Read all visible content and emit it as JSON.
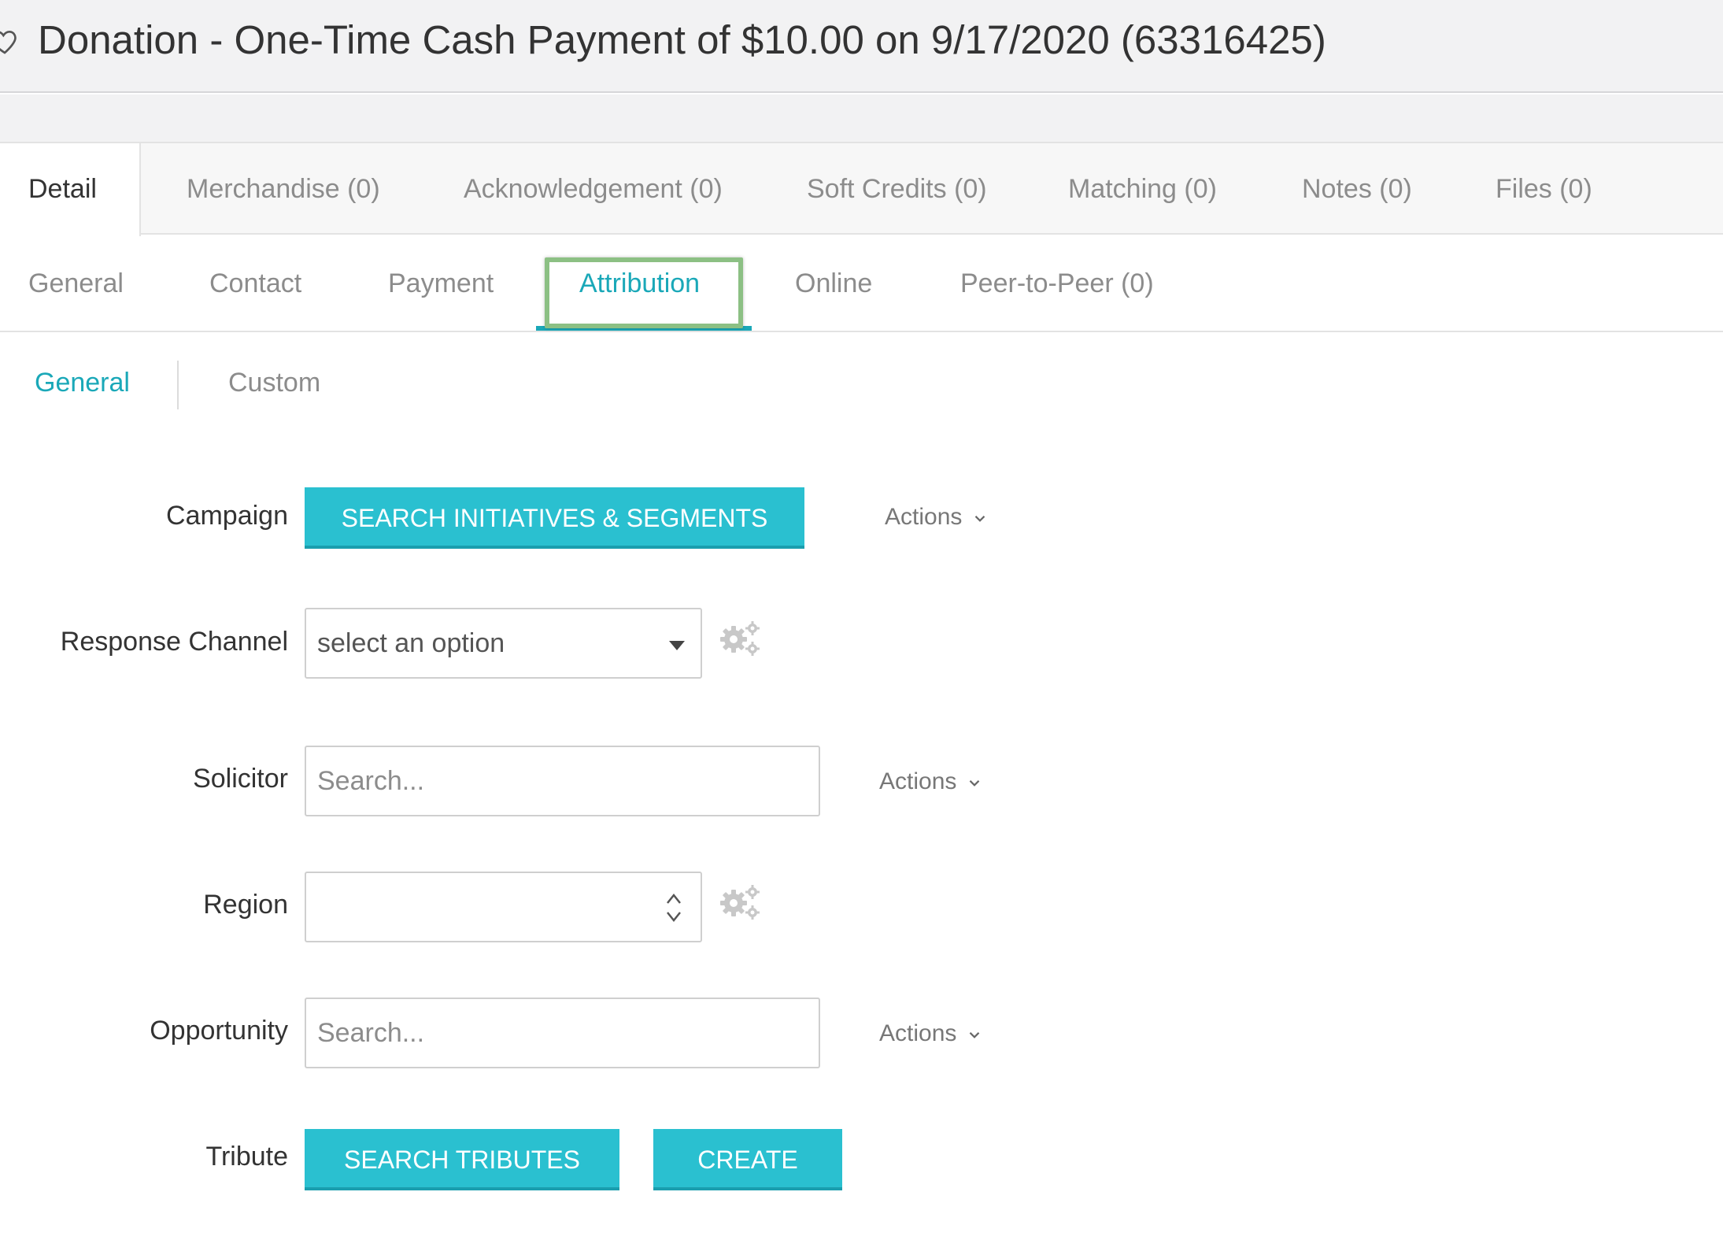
{
  "header": {
    "title": "Donation - One-Time Cash Payment of $10.00 on 9/17/2020 (63316425)",
    "favorite_icon": "heart-outline-icon"
  },
  "main_tabs": [
    {
      "label": "Detail",
      "active": true
    },
    {
      "label": "Merchandise (0)"
    },
    {
      "label": "Acknowledgement (0)"
    },
    {
      "label": "Soft Credits (0)"
    },
    {
      "label": "Matching (0)"
    },
    {
      "label": "Notes (0)"
    },
    {
      "label": "Files (0)"
    }
  ],
  "sub_tabs": [
    {
      "label": "General"
    },
    {
      "label": "Contact"
    },
    {
      "label": "Payment"
    },
    {
      "label": "Attribution",
      "active": true
    },
    {
      "label": "Online"
    },
    {
      "label": "Peer-to-Peer (0)"
    }
  ],
  "section_tabs": [
    {
      "label": "General",
      "active": true
    },
    {
      "label": "Custom"
    }
  ],
  "form": {
    "campaign": {
      "label": "Campaign",
      "button": "SEARCH INITIATIVES & SEGMENTS",
      "actions": "Actions"
    },
    "response_channel": {
      "label": "Response Channel",
      "value": "select an option"
    },
    "solicitor": {
      "label": "Solicitor",
      "placeholder": "Search...",
      "actions": "Actions"
    },
    "region": {
      "label": "Region",
      "value": ""
    },
    "opportunity": {
      "label": "Opportunity",
      "placeholder": "Search...",
      "actions": "Actions"
    },
    "tribute": {
      "label": "Tribute",
      "search_button": "SEARCH TRIBUTES",
      "create_button": "CREATE"
    }
  },
  "colors": {
    "accent": "#2ac0d0",
    "active_tab_text": "#1aa8b8",
    "highlight_box": "#8cc084"
  }
}
